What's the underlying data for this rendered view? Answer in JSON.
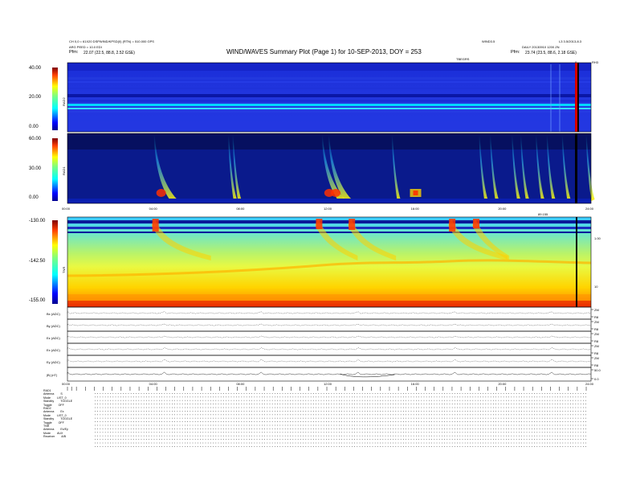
{
  "header": {
    "left_line1": "CH 0,0 = 61X20 DSPWIND/KPSD(0) (RTN) = 510.000 GPS",
    "left_line2": "ARG PEED = 10.0  EDI",
    "left_line3": "Pfm:",
    "left_line3b": "22.07 (22.5, 88.8, 2.52 GSE)",
    "title": "WIND/WAVES Summary Plot (Page 1) for 10-SEP-2013, DOY = 253",
    "right_line1": "DAILY 20130910 1200 ZN",
    "right_line2": "Pfm:",
    "right_line2b": "23.74 (23.5, 88.6, 2.18 GSE)",
    "right_line0a": "WIND3.5",
    "right_line0b": "L3 3.5/2013-8.3",
    "top_small": "TBEGRS",
    "top_small_right": "0",
    "top_small_right2": "RH3"
  },
  "chart_data": [
    {
      "type": "heatmap",
      "panel": "RAD2",
      "ylabel": "RAD2",
      "yticks": [
        "40.00",
        "20.00",
        "0.00"
      ],
      "colorbar": "jet",
      "xlim": [
        0,
        24
      ]
    },
    {
      "type": "heatmap",
      "panel": "RAD1",
      "ylabel": "RAD1",
      "yticks": [
        "60.00",
        "30.00",
        "0.00"
      ],
      "colorbar": "jet",
      "xlim": [
        0,
        24
      ],
      "burst_onsets_hours": [
        4.0,
        7.4,
        7.6,
        11.7,
        12.0,
        14.9,
        18.9,
        19.4,
        20.4,
        20.8,
        21.5,
        22.0,
        22.7,
        23.8
      ]
    },
    {
      "type": "heatmap",
      "panel": "TNR",
      "ylabel": "TNR",
      "yticks": [
        "-130.00",
        "-142.50",
        "-155.00"
      ],
      "right_ticks": [
        "1.00",
        "10"
      ],
      "colorbar": "jet",
      "xlim": [
        0,
        24
      ],
      "xticks": [
        "00:00",
        "04:00",
        "08:00",
        "12:00",
        "16:00",
        "20:00",
        "24:00"
      ],
      "right_top_label": "89.155"
    },
    {
      "type": "line",
      "panel": "Bx",
      "ylabel": "Bx (ADC)",
      "right_ticks": [
        "ZM",
        "R8"
      ]
    },
    {
      "type": "line",
      "panel": "By",
      "ylabel": "By (ADC)",
      "right_ticks": [
        "ZM",
        "R8"
      ]
    },
    {
      "type": "line",
      "panel": "Ez",
      "ylabel": "Ez (ADC)",
      "right_ticks": [
        "ZM",
        "R8"
      ]
    },
    {
      "type": "line",
      "panel": "Ex",
      "ylabel": "Ex (ADC)",
      "right_ticks": [
        "ZM",
        "R8"
      ]
    },
    {
      "type": "line",
      "panel": "Ey",
      "ylabel": "Ey (ADC)",
      "right_ticks": [
        "ZM",
        "R8"
      ]
    },
    {
      "type": "line",
      "panel": "Bt",
      "ylabel": "|B| (nT)",
      "right_ticks": [
        "50.0",
        "0.0"
      ],
      "xticks": [
        "00:00",
        "04:00",
        "08:00",
        "12:00",
        "16:00",
        "20:00",
        "24:00"
      ]
    }
  ],
  "modes": [
    {
      "label": "RAD1",
      "rows": []
    },
    {
      "label": "Antenna",
      "value": "S"
    },
    {
      "label": "Mode",
      "value": "LIST_0"
    },
    {
      "label": "Standby",
      "value": "TOGGLE"
    },
    {
      "label": "Toggle",
      "value": "OFF"
    },
    {
      "label": "RAD2",
      "value": ""
    },
    {
      "label": "Antenna",
      "value": "Ex"
    },
    {
      "label": "Mode",
      "value": "LIST_0"
    },
    {
      "label": "Standby",
      "value": "TOGGLE"
    },
    {
      "label": "Toggle",
      "value": "OFF"
    },
    {
      "label": "TNR",
      "value": ""
    },
    {
      "label": "Antenna",
      "value": "Ex/Ey"
    },
    {
      "label": "Mode",
      "value": "AUX"
    },
    {
      "label": "Receiver",
      "value": "A/B"
    }
  ]
}
